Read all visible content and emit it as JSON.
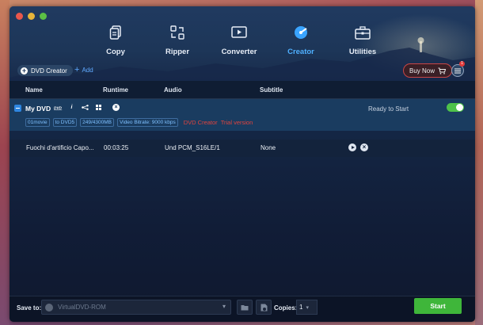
{
  "nav": {
    "items": [
      {
        "label": "Copy",
        "icon": "copy-icon"
      },
      {
        "label": "Ripper",
        "icon": "ripper-icon"
      },
      {
        "label": "Converter",
        "icon": "converter-icon"
      },
      {
        "label": "Creator",
        "icon": "creator-icon",
        "active": true
      },
      {
        "label": "Utilities",
        "icon": "toolbox-icon"
      }
    ]
  },
  "subbar": {
    "dvd_creator_label": "DVD Creator",
    "add_label": "Add",
    "buy_now_label": "Buy Now",
    "menu_badge": "1"
  },
  "table": {
    "headers": {
      "name": "Name",
      "runtime": "Runtime",
      "audio": "Audio",
      "subtitle": "Subtitle"
    }
  },
  "dvd": {
    "name": "My DVD",
    "status": "Ready to Start",
    "tags": [
      "01movie",
      "to DVD5",
      "249/4300MB",
      "Video Bitrate: 9000 kbps"
    ],
    "warning_label": "DVD Creator",
    "trial_label": "Trial version"
  },
  "files": [
    {
      "name": "Fuochi d'artificio Capo...",
      "runtime": "00:03:25",
      "audio": "Und  PCM_S16LE/1",
      "subtitle": "None"
    }
  ],
  "footer": {
    "save_label": "Save to:",
    "save_value": "VirtualDVD-ROM",
    "copies_label": "Copies:",
    "copies_value": "1",
    "start_label": "Start"
  },
  "colors": {
    "accent": "#4fb0ff",
    "start_green": "#3fb63a",
    "warning_red": "#e0443e"
  }
}
